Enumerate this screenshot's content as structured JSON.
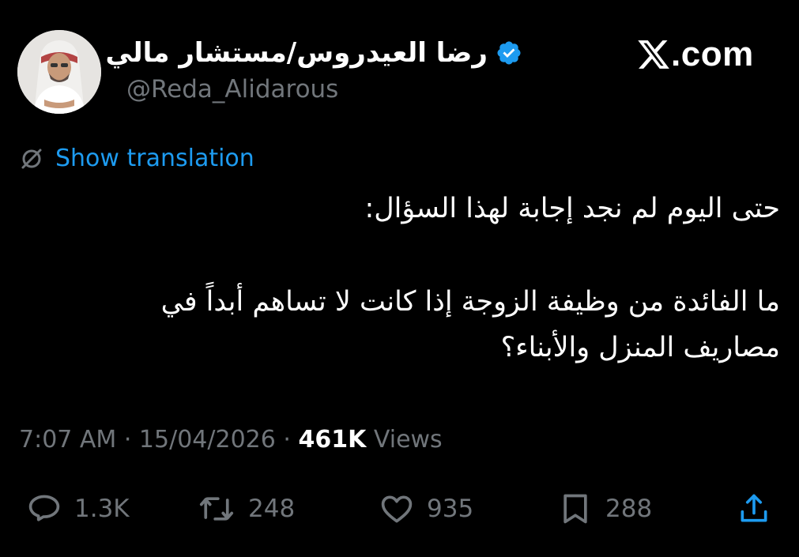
{
  "author": {
    "display_name": "رضا العيدروس/مستشار مالي",
    "handle": "@Reda_Alidarous",
    "verified": true,
    "avatar_icon": "profile-photo"
  },
  "brand": {
    "text": ".com",
    "logo_icon": "x-logo"
  },
  "translation": {
    "label": "Show translation",
    "icon": "globe-slash-icon"
  },
  "tweet": {
    "line1": "حتى اليوم لم نجد إجابة لهذا السؤال:",
    "line2": "ما الفائدة من وظيفة الزوجة إذا كانت لا تساهم أبداً في",
    "line3": "مصاريف المنزل والأبناء؟"
  },
  "meta": {
    "time": "7:07 AM",
    "separator": " · ",
    "date": "15/04/2026",
    "views_count": "461K",
    "views_label": " Views"
  },
  "actions": {
    "replies": "1.3K",
    "retweets": "248",
    "likes": "935",
    "bookmarks": "288"
  },
  "colors": {
    "background": "#000000",
    "text": "#ffffff",
    "muted": "#71767b",
    "link": "#1d9bf0",
    "verified": "#1d9bf0"
  }
}
